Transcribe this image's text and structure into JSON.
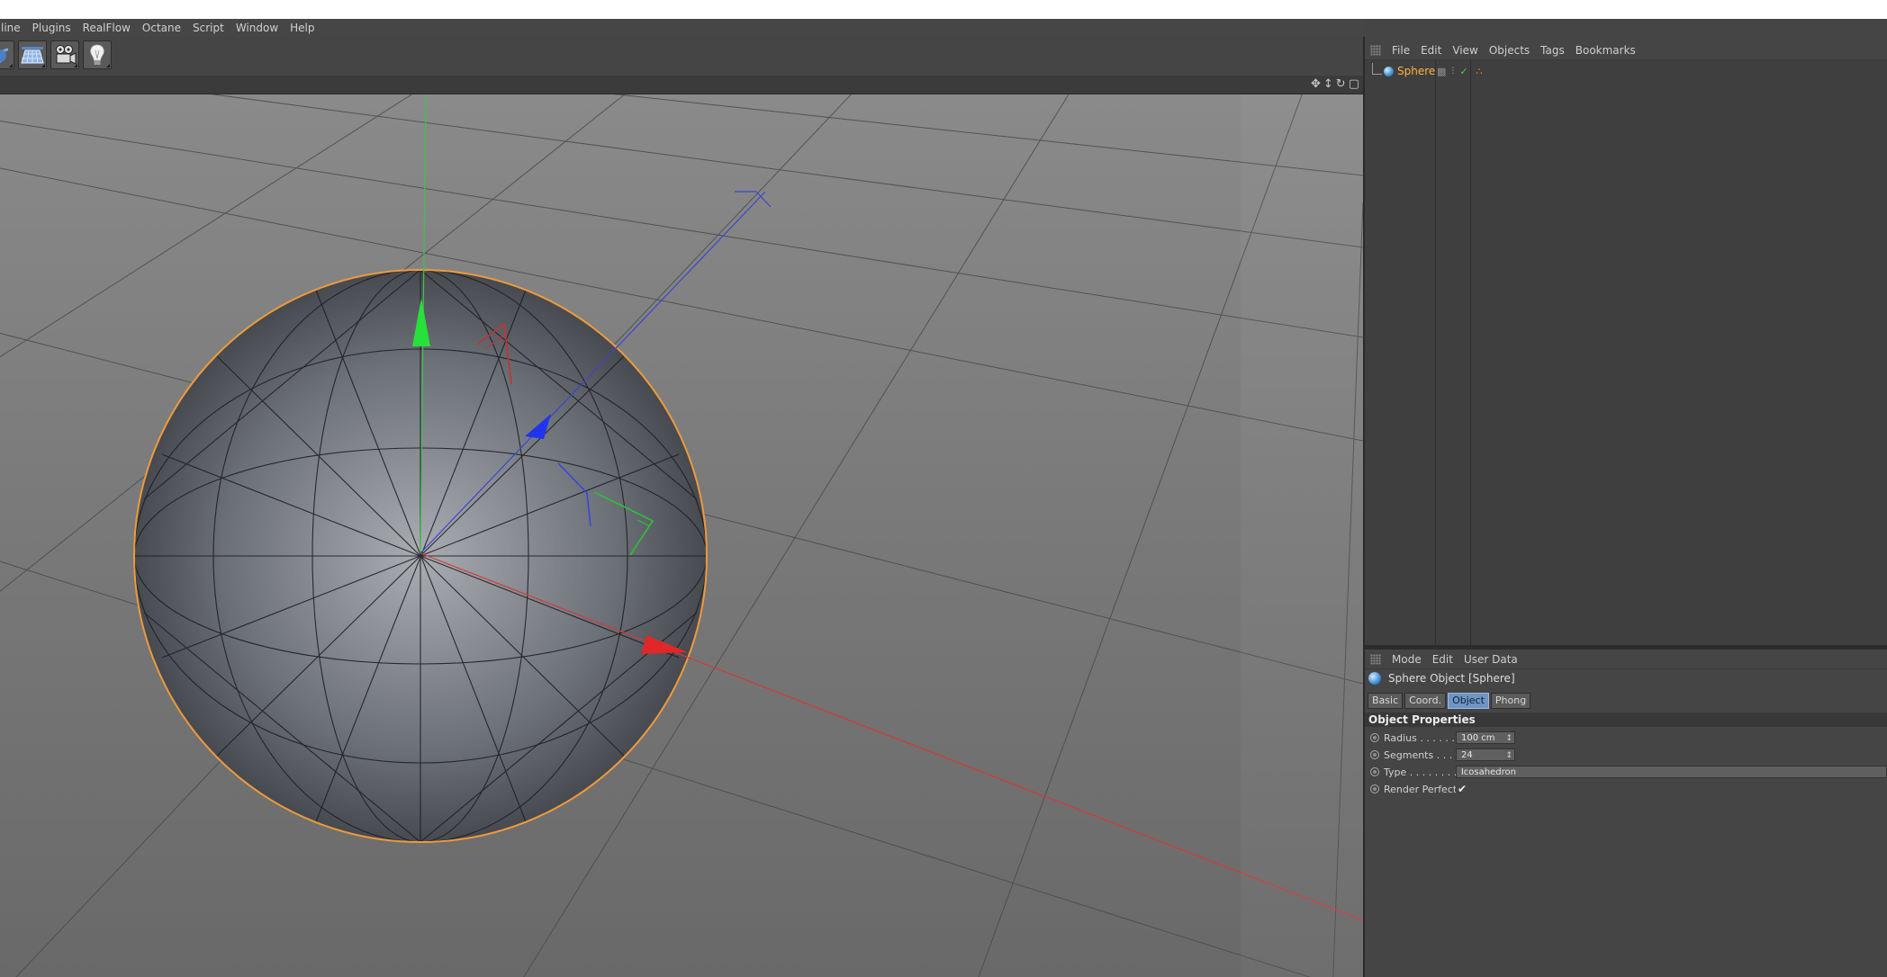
{
  "menubar": {
    "items": [
      "line",
      "Plugins",
      "RealFlow",
      "Octane",
      "Script",
      "Window",
      "Help"
    ]
  },
  "toolbar": {
    "buttons": [
      "primitive-icon",
      "floor-icon",
      "camera-icon",
      "light-bulb-icon"
    ]
  },
  "viewport_header": {
    "icons": [
      "✥",
      "↕",
      "↻",
      "▢"
    ]
  },
  "object_manager": {
    "menu": [
      "File",
      "Edit",
      "View",
      "Objects",
      "Tags",
      "Bookmarks"
    ],
    "objects": [
      {
        "name": "Sphere",
        "icon": "sphere-icon"
      }
    ],
    "colors": {
      "selected_object": "#ffb341"
    }
  },
  "attribute_manager": {
    "menu": [
      "Mode",
      "Edit",
      "User Data"
    ],
    "title": "Sphere Object [Sphere]",
    "tabs": [
      {
        "label": "Basic",
        "active": false
      },
      {
        "label": "Coord.",
        "active": false
      },
      {
        "label": "Object",
        "active": true
      },
      {
        "label": "Phong",
        "active": false
      }
    ],
    "section": "Object Properties",
    "properties": {
      "radius": {
        "label": "Radius . . . . . .",
        "value": "100 cm"
      },
      "segments": {
        "label": "Segments . . . .",
        "value": "24"
      },
      "type": {
        "label": "Type . . . . . . . .",
        "value": "Icosahedron"
      },
      "render_perfect": {
        "label": "Render Perfect",
        "value": "✔"
      }
    }
  }
}
